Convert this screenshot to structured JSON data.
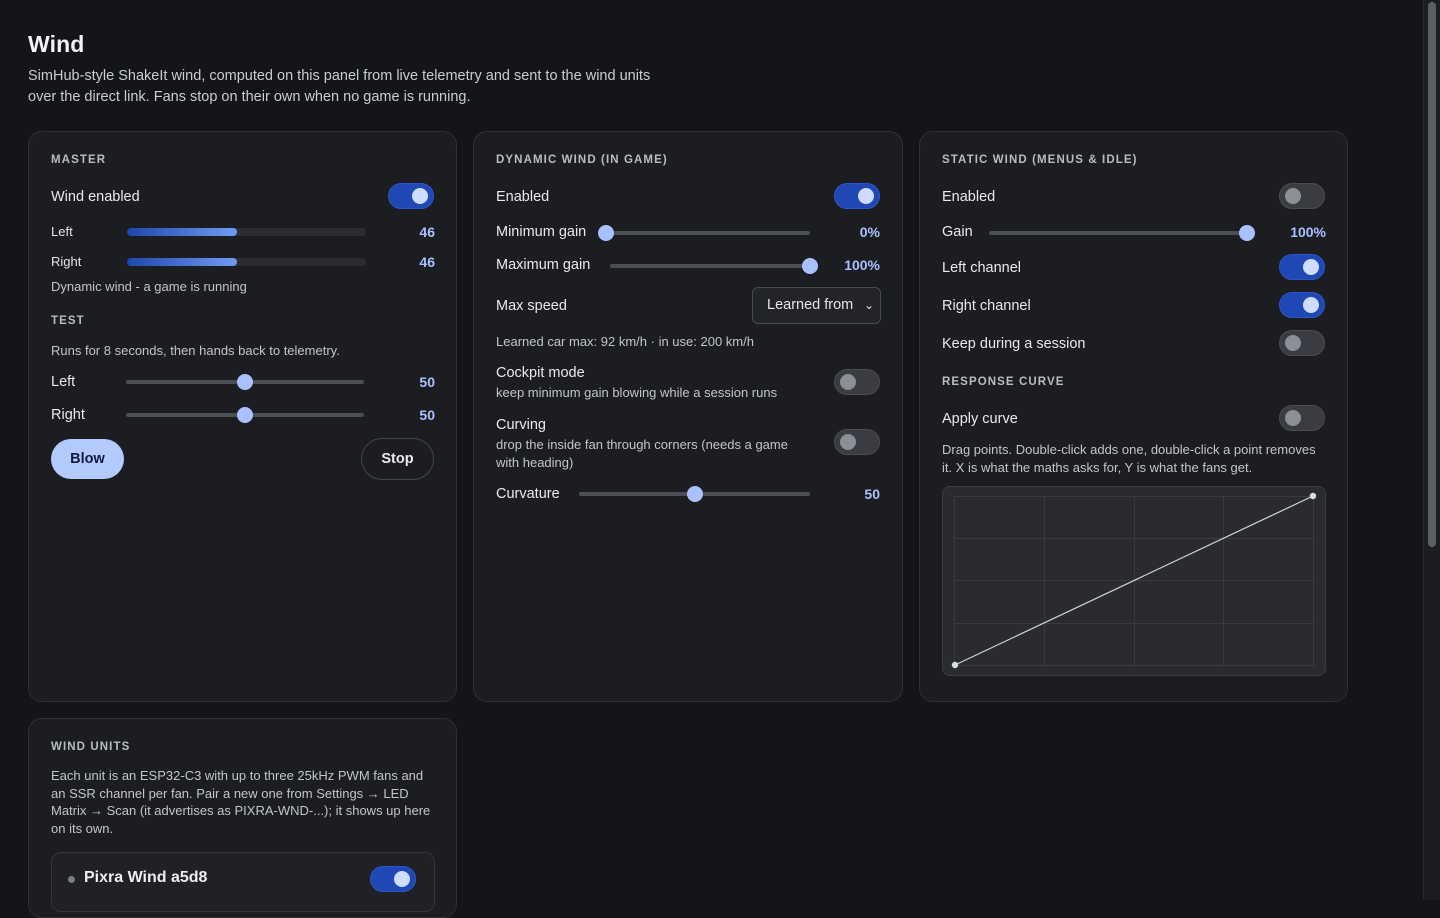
{
  "page": {
    "title": "Wind",
    "subtitle": "SimHub-style ShakeIt wind, computed on this panel from live telemetry and sent to the wind units over the direct link. Fans stop on their own when no game is running."
  },
  "master": {
    "section": "MASTER",
    "wind_enabled_label": "Wind enabled",
    "wind_enabled": true,
    "left_label": "Left",
    "left_value": "46",
    "left_level": 0.46,
    "right_label": "Right",
    "right_value": "46",
    "right_level": 0.46,
    "status": "Dynamic wind - a game is running",
    "test_section": "TEST",
    "test_desc": "Runs for 8 seconds, then hands back to telemetry.",
    "test_left_label": "Left",
    "test_left_value": "50",
    "test_left_level": 0.5,
    "test_right_label": "Right",
    "test_right_value": "50",
    "test_right_level": 0.5,
    "blow_label": "Blow",
    "stop_label": "Stop"
  },
  "dynamic": {
    "section": "DYNAMIC WIND (IN GAME)",
    "enabled_label": "Enabled",
    "enabled": true,
    "min_gain_label": "Minimum gain",
    "min_gain_value": "0%",
    "min_gain_level": 0.0,
    "max_gain_label": "Maximum gain",
    "max_gain_value": "100%",
    "max_gain_level": 1.0,
    "max_speed_label": "Max speed",
    "max_speed_selected": "Learned from",
    "learned_text": "Learned car max: 92 km/h · in use: 200 km/h",
    "cockpit_label": "Cockpit mode",
    "cockpit_desc": "keep minimum gain blowing while a session runs",
    "cockpit": false,
    "curving_label": "Curving",
    "curving_desc": "drop the inside fan through corners (needs a game with heading)",
    "curving": false,
    "curvature_label": "Curvature",
    "curvature_value": "50",
    "curvature_level": 0.5
  },
  "static": {
    "section": "STATIC WIND (MENUS & IDLE)",
    "enabled_label": "Enabled",
    "enabled": false,
    "gain_label": "Gain",
    "gain_value": "100%",
    "gain_level": 1.0,
    "left_channel_label": "Left channel",
    "left_channel": true,
    "right_channel_label": "Right channel",
    "right_channel": true,
    "keep_label": "Keep during a session",
    "keep": false,
    "response_section": "RESPONSE CURVE",
    "apply_curve_label": "Apply curve",
    "apply_curve": false,
    "curve_desc": "Drag points. Double-click adds one, double-click a point removes it. X is what the maths asks for, Y is what the fans get.",
    "curve_points": [
      [
        0,
        0
      ],
      [
        1,
        1
      ]
    ]
  },
  "units": {
    "section": "WIND UNITS",
    "desc": "Each unit is an ESP32-C3 with up to three 25kHz PWM fans and an SSR channel per fan. Pair a new one from Settings → LED Matrix → Scan (it advertises as PIXRA-WND-...); it shows up here on its own.",
    "items": [
      {
        "name": "Pixra Wind a5d8",
        "enabled": true
      }
    ]
  }
}
